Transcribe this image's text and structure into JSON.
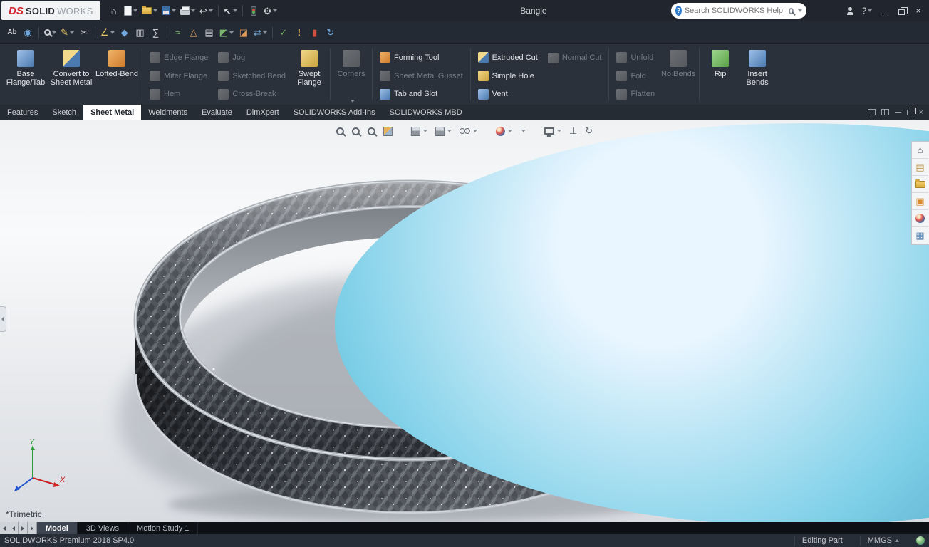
{
  "titlebar": {
    "brand": {
      "ds": "DS",
      "solid": "SOLID",
      "works": "WORKS"
    },
    "icons": {
      "home": "⌂",
      "undo": "↩",
      "select": "↖",
      "options": "⚙",
      "help": "?",
      "minimize": "–",
      "close": "×"
    },
    "document_title": "Bangle",
    "search_placeholder": "Search SOLIDWORKS Help"
  },
  "toolbar2": {
    "icons": [
      {
        "name": "spell-checker",
        "glyph": "Ab"
      },
      {
        "name": "design-binder",
        "glyph": "◉"
      },
      {
        "name": "select-magnifier",
        "glyph": ""
      },
      {
        "name": "comment",
        "glyph": "✎"
      },
      {
        "name": "trim-entities",
        "glyph": "✂"
      },
      {
        "name": "measure",
        "glyph": "∠"
      },
      {
        "name": "mass-properties",
        "glyph": "◆"
      },
      {
        "name": "section-properties",
        "glyph": "▥"
      },
      {
        "name": "equations",
        "glyph": "∑"
      },
      {
        "name": "curvature",
        "glyph": "≈"
      },
      {
        "name": "deviation-analysis",
        "glyph": "△"
      },
      {
        "name": "zebra-stripes",
        "glyph": "▤"
      },
      {
        "name": "draft-analysis",
        "glyph": "◩"
      },
      {
        "name": "thickness-analysis",
        "glyph": "◪"
      },
      {
        "name": "compare-documents",
        "glyph": "⇄"
      },
      {
        "name": "check-entity",
        "glyph": "✓"
      },
      {
        "name": "import-diagnostics",
        "glyph": "!"
      },
      {
        "name": "material",
        "glyph": "▮"
      },
      {
        "name": "pack-and-go",
        "glyph": "↻"
      }
    ]
  },
  "ribbon": {
    "base_flange": "Base Flange/Tab",
    "convert": "Convert to Sheet Metal",
    "lofted": "Lofted-Bend",
    "edge_flange": "Edge Flange",
    "miter_flange": "Miter Flange",
    "hem": "Hem",
    "jog": "Jog",
    "sketched_bend": "Sketched Bend",
    "cross_break": "Cross-Break",
    "swept_flange": "Swept Flange",
    "corners": "Corners",
    "forming_tool": "Forming Tool",
    "gusset": "Sheet Metal Gusset",
    "tab_slot": "Tab and Slot",
    "extruded_cut": "Extruded Cut",
    "simple_hole": "Simple Hole",
    "vent": "Vent",
    "normal_cut": "Normal Cut",
    "unfold": "Unfold",
    "fold": "Fold",
    "flatten": "Flatten",
    "no_bends": "No Bends",
    "rip": "Rip",
    "insert_bends": "Insert Bends"
  },
  "tabs": {
    "items": [
      "Features",
      "Sketch",
      "Sheet Metal",
      "Weldments",
      "Evaluate",
      "DimXpert",
      "SOLIDWORKS Add-Ins",
      "SOLIDWORKS MBD"
    ],
    "active": "Sheet Metal",
    "window": {
      "minimize": "–",
      "close": "×"
    }
  },
  "headsup": {
    "glyph_drawing": "⊥",
    "glyph_rotate": "↻"
  },
  "taskpane": {
    "glyphs": {
      "home": "⌂",
      "library": "▤",
      "palette": "▣",
      "properties": "▦"
    }
  },
  "viewport": {
    "view_label": "*Trimetric",
    "axes": {
      "x": "X",
      "y": "Y"
    }
  },
  "bottombar": {
    "tabs": [
      "Model",
      "3D Views",
      "Motion Study 1"
    ]
  },
  "statusbar": {
    "product": "SOLIDWORKS Premium 2018 SP4.0",
    "mode": "Editing Part",
    "units": "MMGS"
  },
  "colors": {
    "titlebar_bg": "#21262e",
    "ribbon_bg": "#2a313a",
    "active_tab_bg": "#ffffff",
    "model_dark": "#33373d",
    "viewport_top": "#eff1f3",
    "viewport_bottom": "#d8dbe0"
  }
}
